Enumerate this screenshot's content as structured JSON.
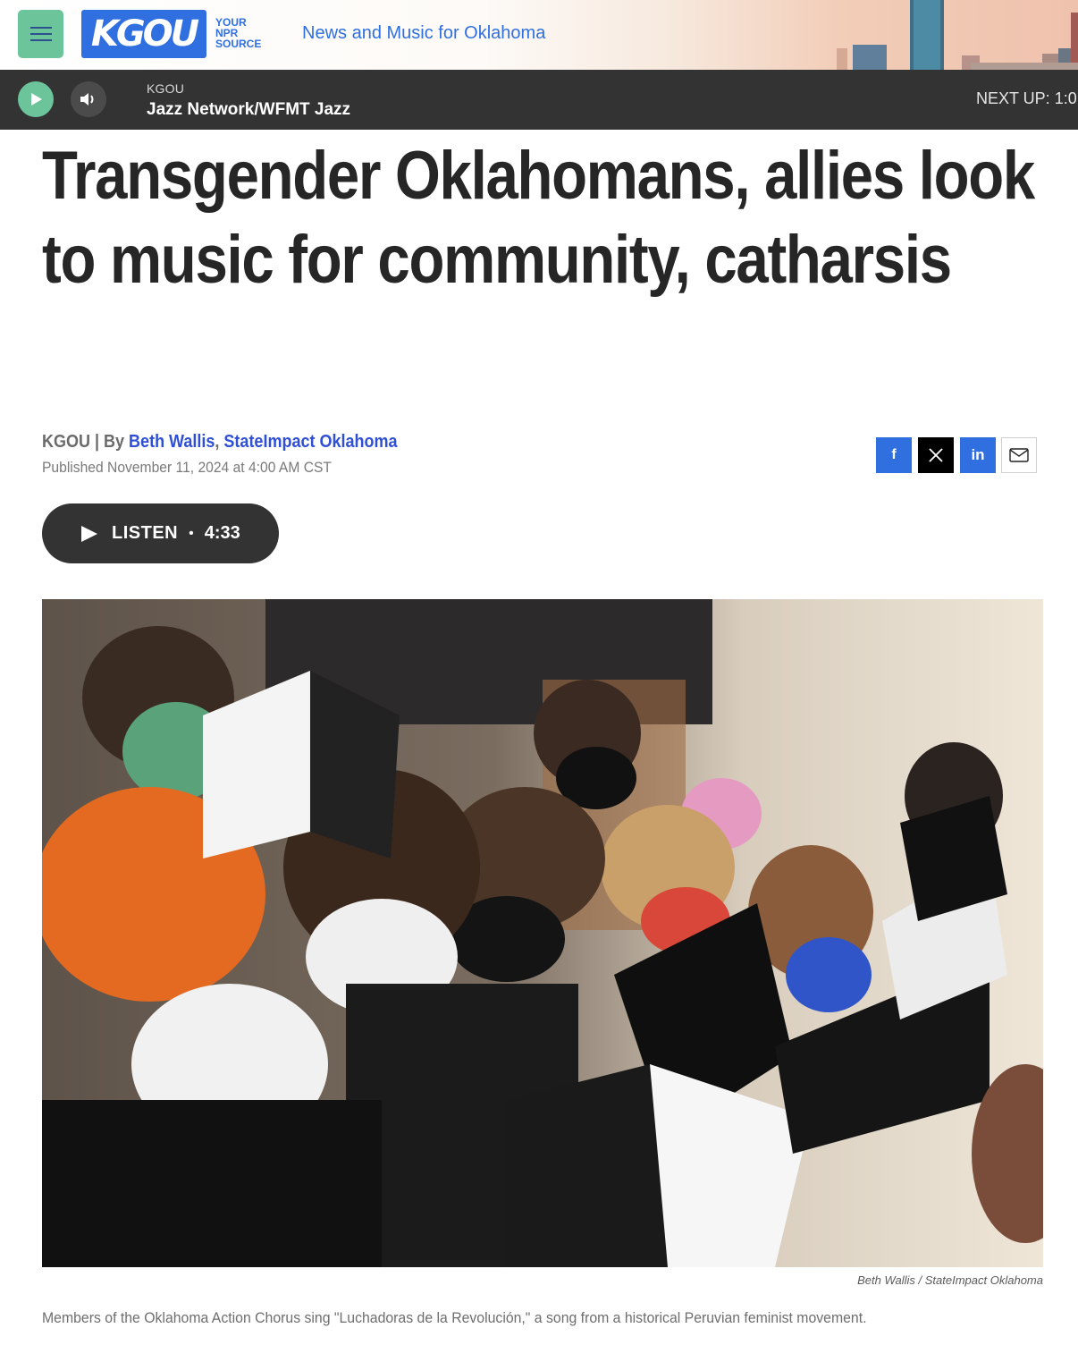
{
  "header": {
    "menu_icon": "hamburger-menu-icon",
    "logo_text": "KGOU",
    "logo_tagline": [
      "YOUR",
      "NPR",
      "SOURCE"
    ],
    "tagline": "News and Music for Oklahoma",
    "colors": {
      "accent": "#2f6fe0",
      "menu_bg": "#6cc59a"
    }
  },
  "player": {
    "play_icon": "play-icon",
    "volume_icon": "volume-icon",
    "station": "KGOU",
    "program": "Jazz Network/WFMT Jazz",
    "next_up": "NEXT UP:  1:0",
    "bg_color": "#333333"
  },
  "article": {
    "headline": "Transgender Oklahomans, allies look to music for community, catharsis",
    "byline": {
      "source": "KGOU",
      "separator": " | By ",
      "author": "Beth Wallis",
      "comma": ", ",
      "outlet": "StateImpact Oklahoma"
    },
    "published": "Published November 11, 2024 at 4:00 AM CST",
    "share": [
      {
        "name": "facebook",
        "icon": "facebook-icon",
        "glyph": "f"
      },
      {
        "name": "x",
        "icon": "x-icon",
        "glyph": "𝕏"
      },
      {
        "name": "linkedin",
        "icon": "linkedin-icon",
        "glyph": "in"
      },
      {
        "name": "email",
        "icon": "email-icon"
      }
    ],
    "listen": {
      "label": "LISTEN",
      "dot": "•",
      "duration": "4:33"
    },
    "image": {
      "credit": "Beth Wallis  /  StateImpact Oklahoma",
      "caption": "Members of the Oklahoma Action Chorus sing \"Luchadoras de la Revolución,\" a song from a historical Peruvian feminist movement."
    }
  }
}
